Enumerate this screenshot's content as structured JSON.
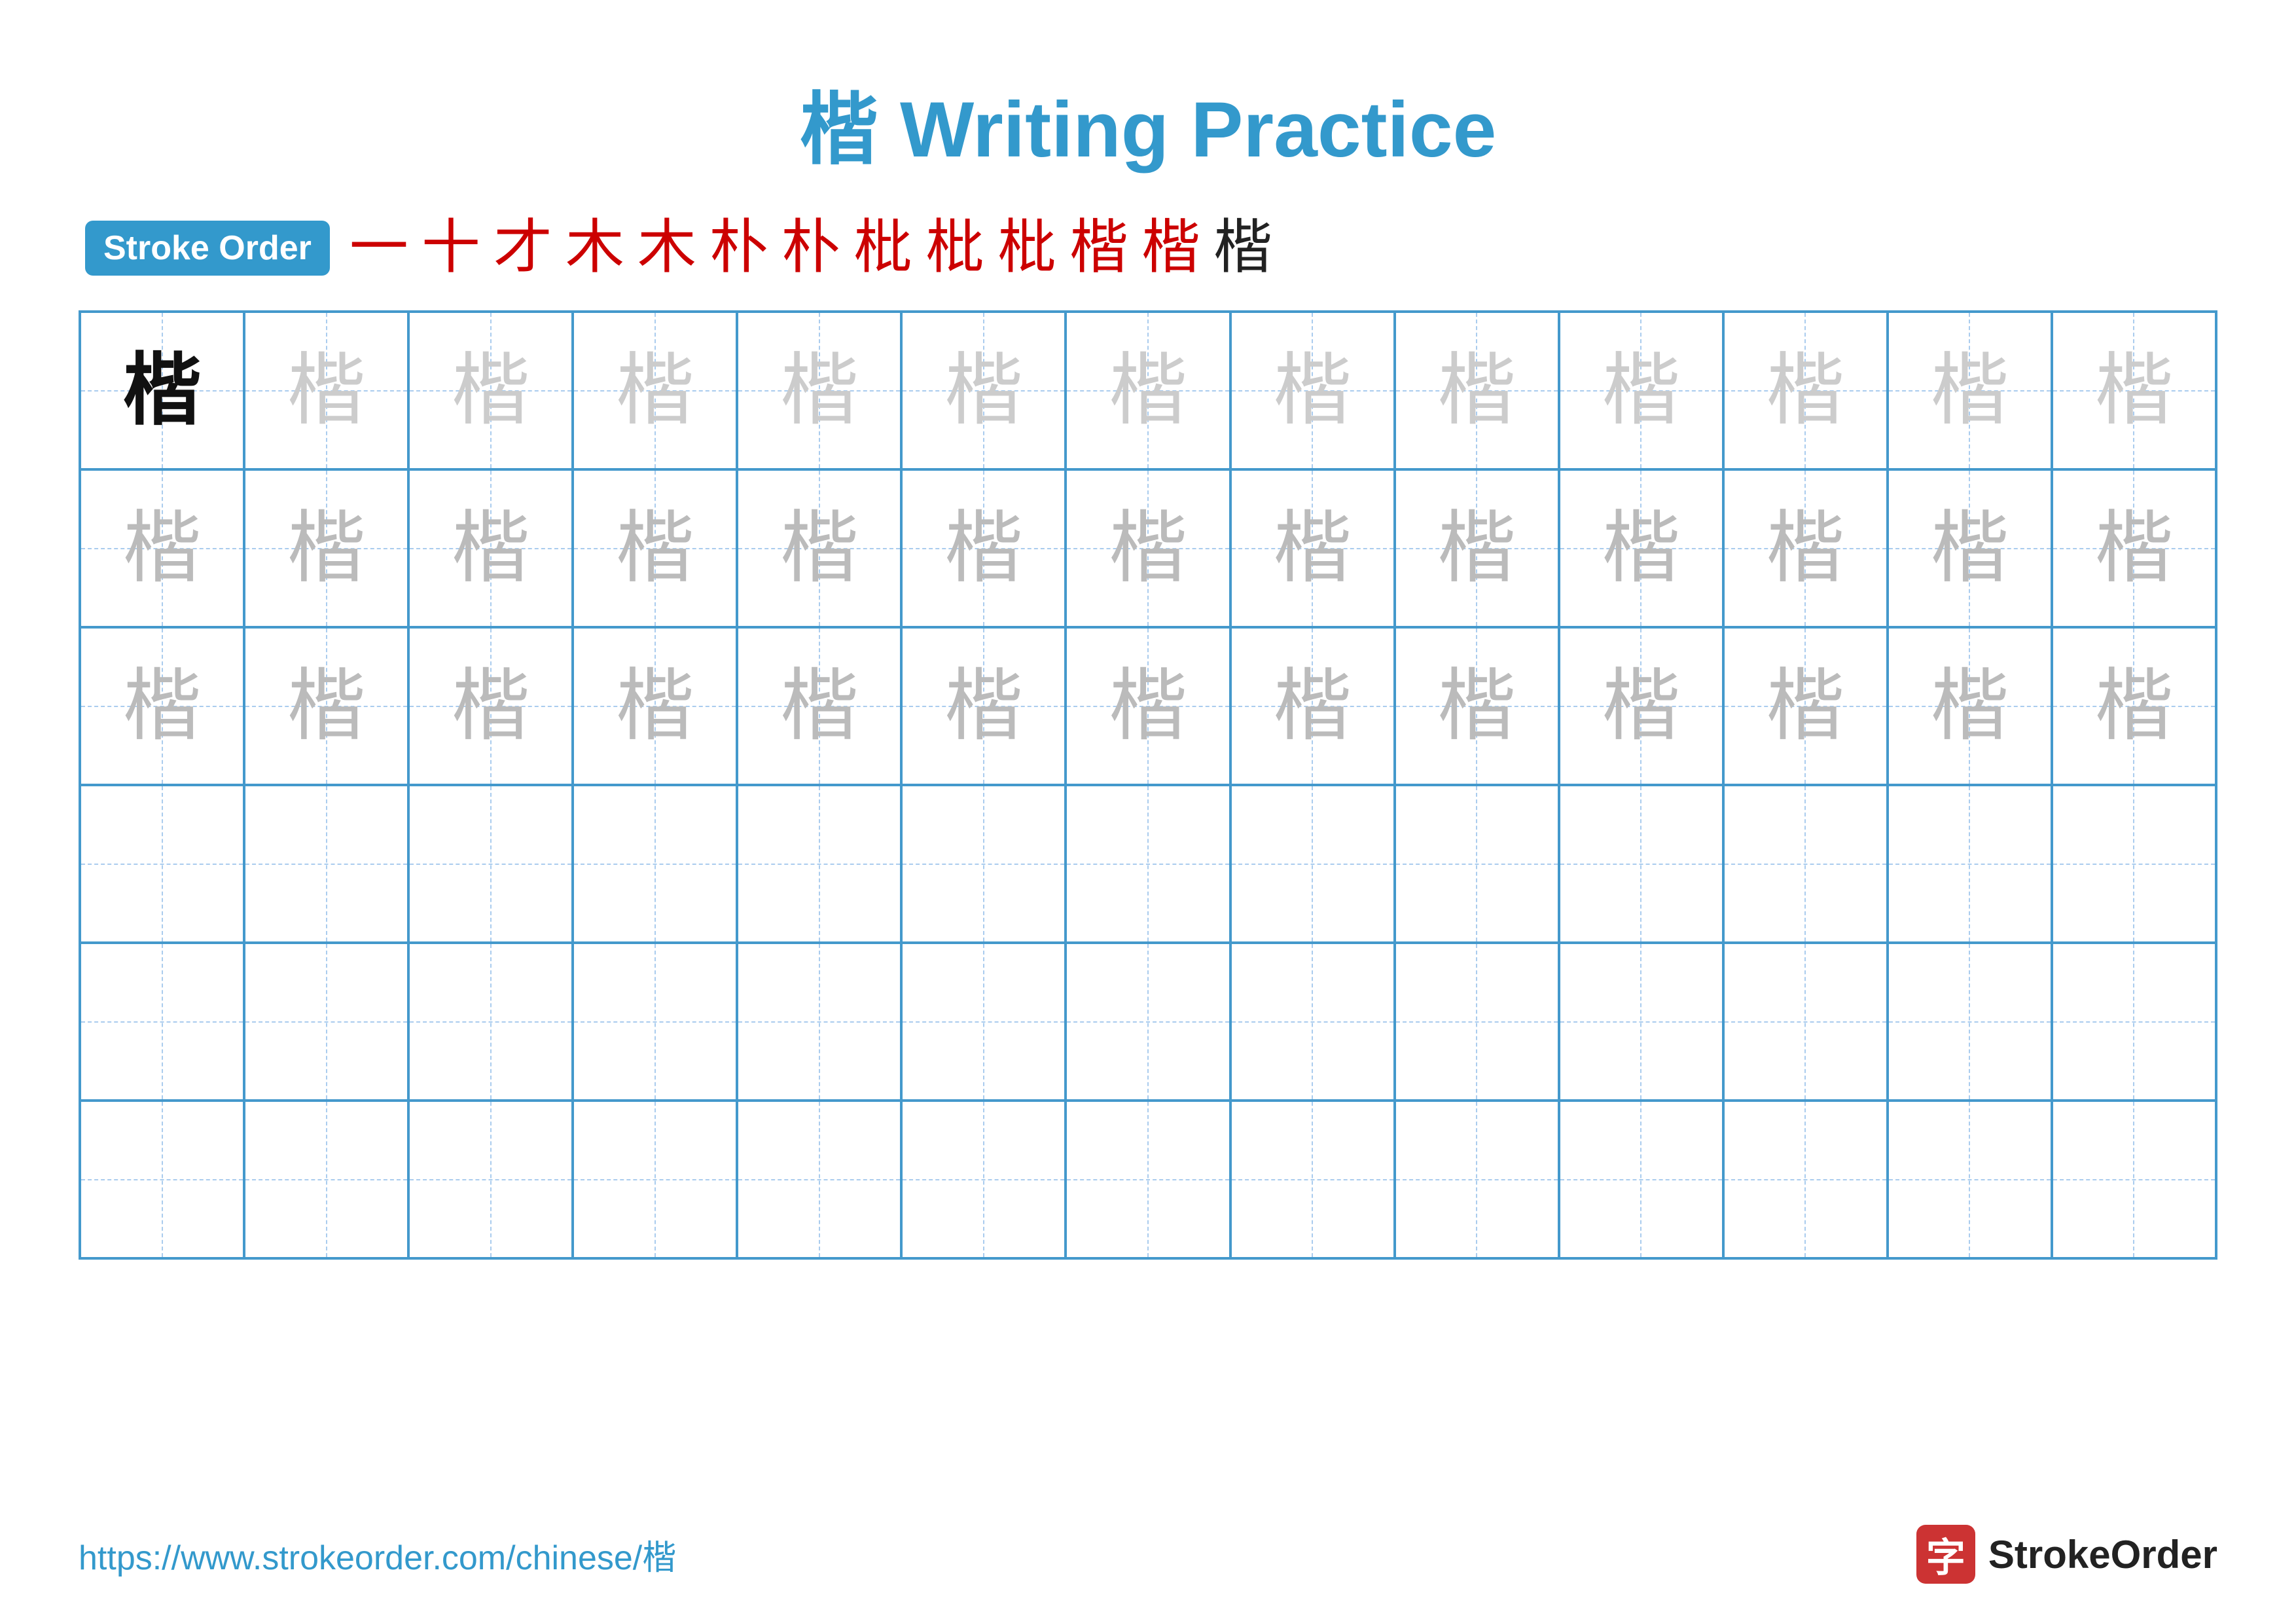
{
  "title": "楷 Writing Practice",
  "stroke_order": {
    "badge_label": "Stroke Order",
    "strokes": [
      "一",
      "十",
      "才",
      "木",
      "木",
      "朴",
      "朴",
      "枇",
      "枇",
      "枇",
      "楷",
      "楷",
      "楷"
    ]
  },
  "grid": {
    "rows": 6,
    "cols": 13,
    "character": "楷",
    "cells": [
      {
        "row": 0,
        "col": 0,
        "style": "bold-black"
      },
      {
        "row": 0,
        "col": 1,
        "style": "light-gray"
      },
      {
        "row": 0,
        "col": 2,
        "style": "light-gray"
      },
      {
        "row": 0,
        "col": 3,
        "style": "light-gray"
      },
      {
        "row": 0,
        "col": 4,
        "style": "light-gray"
      },
      {
        "row": 0,
        "col": 5,
        "style": "light-gray"
      },
      {
        "row": 0,
        "col": 6,
        "style": "light-gray"
      },
      {
        "row": 0,
        "col": 7,
        "style": "light-gray"
      },
      {
        "row": 0,
        "col": 8,
        "style": "light-gray"
      },
      {
        "row": 0,
        "col": 9,
        "style": "light-gray"
      },
      {
        "row": 0,
        "col": 10,
        "style": "light-gray"
      },
      {
        "row": 0,
        "col": 11,
        "style": "light-gray"
      },
      {
        "row": 0,
        "col": 12,
        "style": "light-gray"
      },
      {
        "row": 1,
        "col": 0,
        "style": "medium-gray"
      },
      {
        "row": 1,
        "col": 1,
        "style": "medium-gray"
      },
      {
        "row": 1,
        "col": 2,
        "style": "medium-gray"
      },
      {
        "row": 1,
        "col": 3,
        "style": "medium-gray"
      },
      {
        "row": 1,
        "col": 4,
        "style": "medium-gray"
      },
      {
        "row": 1,
        "col": 5,
        "style": "medium-gray"
      },
      {
        "row": 1,
        "col": 6,
        "style": "medium-gray"
      },
      {
        "row": 1,
        "col": 7,
        "style": "medium-gray"
      },
      {
        "row": 1,
        "col": 8,
        "style": "medium-gray"
      },
      {
        "row": 1,
        "col": 9,
        "style": "medium-gray"
      },
      {
        "row": 1,
        "col": 10,
        "style": "medium-gray"
      },
      {
        "row": 1,
        "col": 11,
        "style": "medium-gray"
      },
      {
        "row": 1,
        "col": 12,
        "style": "medium-gray"
      },
      {
        "row": 2,
        "col": 0,
        "style": "medium-gray"
      },
      {
        "row": 2,
        "col": 1,
        "style": "medium-gray"
      },
      {
        "row": 2,
        "col": 2,
        "style": "medium-gray"
      },
      {
        "row": 2,
        "col": 3,
        "style": "medium-gray"
      },
      {
        "row": 2,
        "col": 4,
        "style": "medium-gray"
      },
      {
        "row": 2,
        "col": 5,
        "style": "medium-gray"
      },
      {
        "row": 2,
        "col": 6,
        "style": "medium-gray"
      },
      {
        "row": 2,
        "col": 7,
        "style": "medium-gray"
      },
      {
        "row": 2,
        "col": 8,
        "style": "medium-gray"
      },
      {
        "row": 2,
        "col": 9,
        "style": "medium-gray"
      },
      {
        "row": 2,
        "col": 10,
        "style": "medium-gray"
      },
      {
        "row": 2,
        "col": 11,
        "style": "medium-gray"
      },
      {
        "row": 2,
        "col": 12,
        "style": "medium-gray"
      }
    ]
  },
  "footer": {
    "url": "https://www.strokeorder.com/chinese/楷",
    "logo_char": "字",
    "logo_text": "StrokeOrder"
  }
}
